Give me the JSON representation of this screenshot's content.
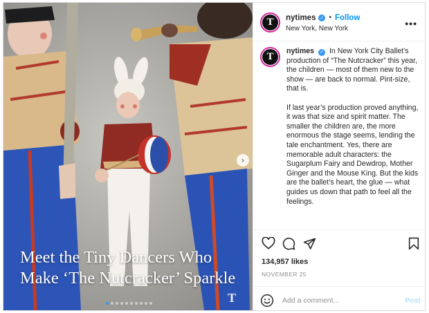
{
  "account": {
    "username": "nytimes",
    "avatar_letter": "T",
    "follow_label": "Follow",
    "separator": "•",
    "location": "New York, New York",
    "more_icon": "more-horizontal-icon",
    "more_glyph": "•••",
    "verified_glyph": "✓"
  },
  "media": {
    "headline_line1": "Meet the Tiny Dancers Who",
    "headline_line2": "Make ‘The Nutcracker’ Sparkle",
    "watermark": "T",
    "next_glyph": "›",
    "carousel": {
      "total": 10,
      "active": 0
    }
  },
  "caption": {
    "username": "nytimes",
    "paragraph1": "In New York City Ballet’s production of “The Nutcracker” this year, the children — most of them new to the show — are back to normal. Pint-size, that is.",
    "paragraph2": "If last year’s production proved anything, it was that size and spirit matter. The smaller the children are, the more enormous the stage seems, lending the tale enchantment. Yes, there are memorable adult characters: the Sugarplum Fairy and Dewdrop, Mother Ginger and the Mouse King. But the kids are the ballet’s heart, the glue — what guides us down that path to feel all the feelings."
  },
  "actions": {
    "icons": [
      "heart-icon",
      "comment-icon",
      "share-icon",
      "bookmark-icon"
    ]
  },
  "likes": "134,957 likes",
  "date": "NOVEMBER 25",
  "comment": {
    "placeholder": "Add a comment...",
    "post_label": "Post",
    "emoji_icon": "emoji-icon"
  },
  "colors": {
    "accent": "#0095f6",
    "verified": "#3897f0",
    "post_disabled": "#b2dffc",
    "carousel_active": "#3797f0"
  }
}
